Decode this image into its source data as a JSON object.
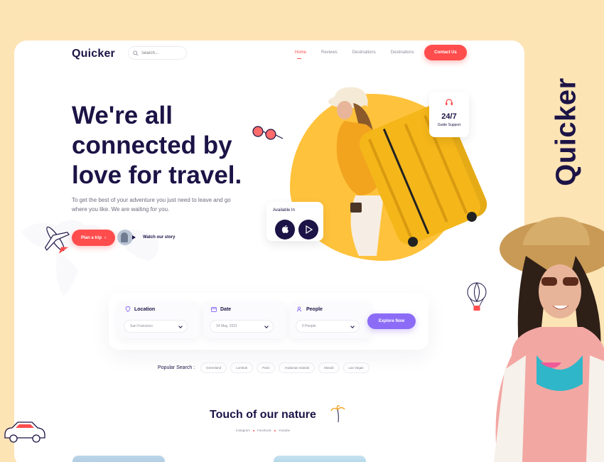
{
  "brand": {
    "name": "Quicker",
    "side_name": "Quicker"
  },
  "header": {
    "search_placeholder": "Search...",
    "nav": [
      "Home",
      "Reviews",
      "Destinations",
      "Destinations"
    ],
    "contact_label": "Contact Us"
  },
  "hero": {
    "headline": "We're all connected by love for travel.",
    "subtext": "To get the best of your adventure you just need to leave and go where you like. We are waiting for you.",
    "plan_label": "Plan a trip",
    "watch_label": "Watch our story",
    "support_big": "24/7",
    "support_small": "Guide Support",
    "available_label": "Available In"
  },
  "search_panel": {
    "fields": [
      {
        "label": "Location",
        "value": "San Francisco"
      },
      {
        "label": "Date",
        "value": "14 May, 2021"
      },
      {
        "label": "People",
        "value": "5 People"
      }
    ],
    "explore_label": "Explore Now"
  },
  "popular": {
    "label": "Popular Search :",
    "chips": [
      "Greenland",
      "Lombok",
      "Paris",
      "Andaman Islands",
      "Manali",
      "Las Vegas"
    ]
  },
  "section": {
    "title": "Touch of our nature",
    "socials": [
      "Instagram",
      "Facebook",
      "Youtube"
    ]
  },
  "colors": {
    "background": "#fde4b5",
    "accent": "#ff4d4d",
    "navy": "#1c1346",
    "purple": "#8c6cf7",
    "yellow": "#ffc23c"
  }
}
